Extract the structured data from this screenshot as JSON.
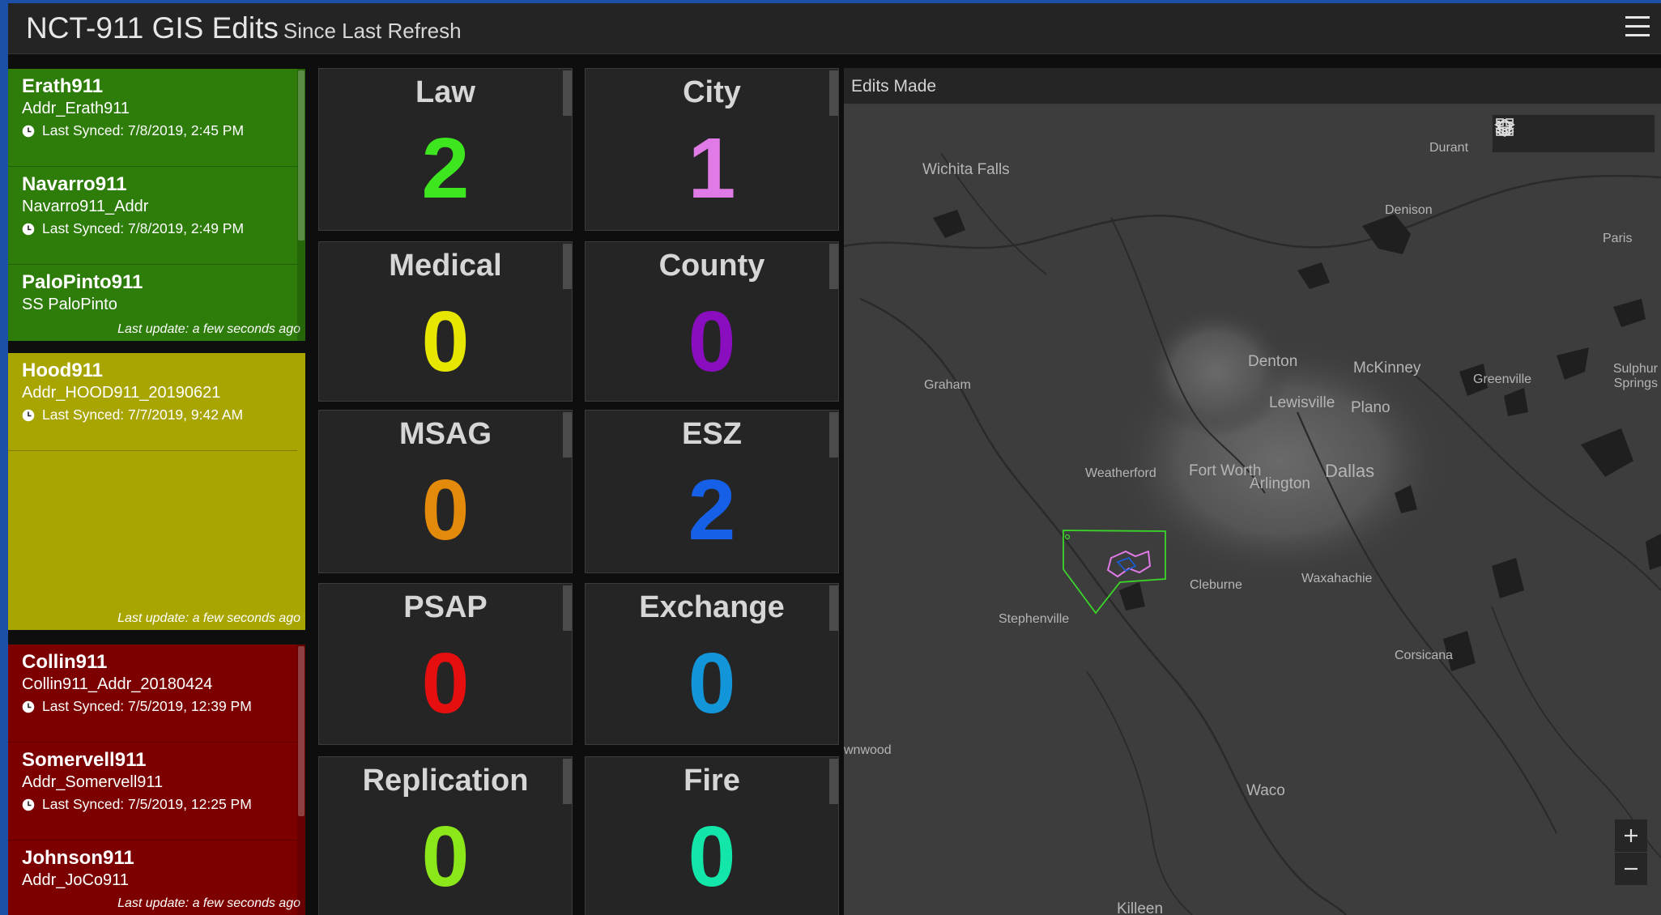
{
  "header": {
    "title": "NCT-911 GIS Edits",
    "subtitle": "Since Last Refresh",
    "menu_icon": "hamburger-menu-icon"
  },
  "status_lists": [
    {
      "color": "#2e7d0a",
      "last_update": "Last update: a few seconds ago",
      "items": [
        {
          "name": "Erath911",
          "layer": "Addr_Erath911",
          "synced": "Last Synced: 7/8/2019, 2:45 PM"
        },
        {
          "name": "Navarro911",
          "layer": "Navarro911_Addr",
          "synced": "Last Synced: 7/8/2019, 2:49 PM"
        },
        {
          "name": "PaloPinto911",
          "layer": "SS  PaloPinto",
          "synced": ""
        }
      ]
    },
    {
      "color": "#a8a400",
      "last_update": "Last update: a few seconds ago",
      "items": [
        {
          "name": "Hood911",
          "layer": "Addr_HOOD911_20190621",
          "synced": "Last Synced: 7/7/2019, 9:42 AM"
        }
      ]
    },
    {
      "color": "#7d0000",
      "last_update": "Last update: a few seconds ago",
      "items": [
        {
          "name": "Collin911",
          "layer": "Collin911_Addr_20180424",
          "synced": "Last Synced: 7/5/2019, 12:39 PM"
        },
        {
          "name": "Somervell911",
          "layer": "Addr_Somervell911",
          "synced": "Last Synced: 7/5/2019, 12:25 PM"
        },
        {
          "name": "Johnson911",
          "layer": "Addr_JoCo911",
          "synced": ""
        }
      ]
    }
  ],
  "counters": [
    {
      "label": "Law",
      "value": "2",
      "color": "#3ee61f"
    },
    {
      "label": "City",
      "value": "1",
      "color": "#e07ae6"
    },
    {
      "label": "Medical",
      "value": "0",
      "color": "#e6e600"
    },
    {
      "label": "County",
      "value": "0",
      "color": "#8a0dbf"
    },
    {
      "label": "MSAG",
      "value": "0",
      "color": "#e38a0a"
    },
    {
      "label": "ESZ",
      "value": "2",
      "color": "#1560e6"
    },
    {
      "label": "PSAP",
      "value": "0",
      "color": "#e60f0f"
    },
    {
      "label": "Exchange",
      "value": "0",
      "color": "#1396d9"
    },
    {
      "label": "Replication",
      "value": "0",
      "color": "#8be61a"
    },
    {
      "label": "Fire",
      "value": "0",
      "color": "#12e6a8"
    }
  ],
  "map": {
    "title": "Edits Made",
    "tools": [
      "home-icon",
      "legend-list-icon",
      "layers-icon",
      "basemap-gallery-icon"
    ],
    "zoom_in": "+",
    "zoom_out": "–",
    "cities": [
      {
        "name": "Wichita Falls",
        "size": "large"
      },
      {
        "name": "Durant",
        "size": "small"
      },
      {
        "name": "Denison",
        "size": "small"
      },
      {
        "name": "Paris",
        "size": "small"
      },
      {
        "name": "Graham",
        "size": "small"
      },
      {
        "name": "Denton",
        "size": "large"
      },
      {
        "name": "McKinney",
        "size": "large"
      },
      {
        "name": "Greenville",
        "size": "small"
      },
      {
        "name": "Sulphur Springs",
        "size": "small"
      },
      {
        "name": "Lewisville",
        "size": "large"
      },
      {
        "name": "Plano",
        "size": "large"
      },
      {
        "name": "Weatherford",
        "size": "small"
      },
      {
        "name": "Fort Worth",
        "size": "large"
      },
      {
        "name": "Arlington",
        "size": "large"
      },
      {
        "name": "Dallas",
        "size": "xlarge"
      },
      {
        "name": "Cleburne",
        "size": "small"
      },
      {
        "name": "Waxahachie",
        "size": "small"
      },
      {
        "name": "Stephenville",
        "size": "small"
      },
      {
        "name": "Corsicana",
        "size": "small"
      },
      {
        "name": "wnwood",
        "size": "small"
      },
      {
        "name": "Waco",
        "size": "large"
      },
      {
        "name": "Killeen",
        "size": "large"
      }
    ]
  }
}
